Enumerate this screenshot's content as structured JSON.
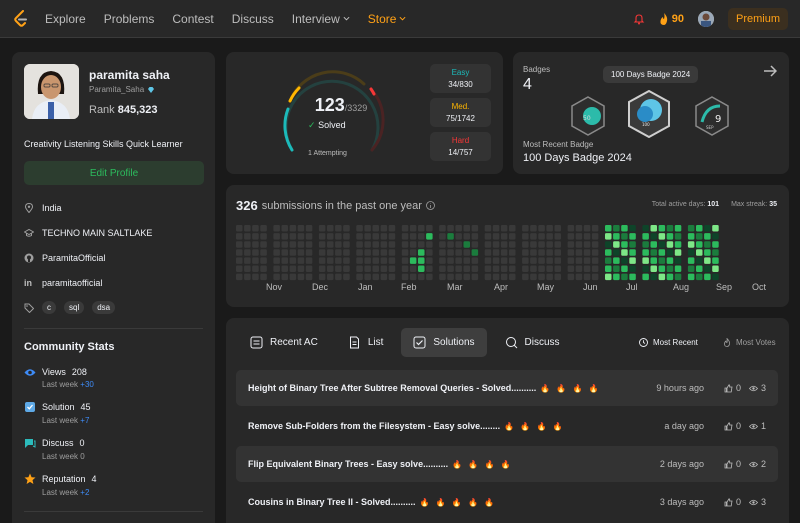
{
  "nav": {
    "items": [
      "Explore",
      "Problems",
      "Contest",
      "Discuss"
    ],
    "interview": "Interview",
    "store": "Store",
    "streak": "90",
    "premium": "Premium"
  },
  "profile": {
    "name": "paramita saha",
    "username": "Paramita_Saha",
    "rank_label": "Rank",
    "rank_value": "845,323",
    "bio": "Creativity Listening Skills Quick Learner",
    "edit_button": "Edit Profile",
    "location": "India",
    "school": "TECHNO MAIN SALTLAKE",
    "github": "ParamitaOfficial",
    "linkedin": "paramitaofficial",
    "tags": [
      "c",
      "sql",
      "dsa"
    ]
  },
  "community": {
    "title": "Community Stats",
    "stats": [
      {
        "label": "Views",
        "value": "208",
        "sub": "Last week",
        "delta": "+30",
        "color": "#3e8bf6"
      },
      {
        "label": "Solution",
        "value": "45",
        "sub": "Last week",
        "delta": "+7",
        "color": "#3e8bf6"
      },
      {
        "label": "Discuss",
        "value": "0",
        "sub": "Last week",
        "delta": "0",
        "color": "#2cbbbb"
      },
      {
        "label": "Reputation",
        "value": "4",
        "sub": "Last week",
        "delta": "+2",
        "color": "#ffa116"
      }
    ]
  },
  "solved": {
    "count": "123",
    "total": "/3329",
    "label": "Solved",
    "attempting": "1 Attempting",
    "easy_label": "Easy",
    "easy_value": "34/830",
    "medium_label": "Med.",
    "medium_value": "75/1742",
    "hard_label": "Hard",
    "hard_value": "14/757",
    "colors": {
      "easy": "#1cbaba",
      "medium": "#ffb700",
      "hard": "#f63737"
    }
  },
  "badges": {
    "label": "Badges",
    "count": "4",
    "tooltip": "100 Days Badge 2024",
    "recent_label": "Most Recent Badge",
    "recent_value": "100 Days Badge 2024",
    "items": [
      {
        "name": "badge-50-days",
        "text": "50"
      },
      {
        "name": "badge-100-days",
        "text": "100"
      },
      {
        "name": "badge-sep",
        "text": "SEP"
      }
    ]
  },
  "heatmap": {
    "count": "326",
    "title": "submissions in the past one year",
    "active_label": "Total active days:",
    "active_value": "101",
    "streak_label": "Max streak:",
    "streak_value": "35",
    "months": [
      "Nov",
      "Dec",
      "Jan",
      "Feb",
      "Mar",
      "Apr",
      "May",
      "Jun",
      "Jul",
      "Aug",
      "Sep",
      "Oct"
    ],
    "colors": {
      "empty": "#393939",
      "l1": "#0e4429",
      "l2": "#1b7c3d",
      "l3": "#2cbb5d",
      "l4": "#7ee787"
    }
  },
  "solutions": {
    "tabs": [
      "Recent AC",
      "List",
      "Solutions",
      "Discuss"
    ],
    "active_tab": "Solutions",
    "sort_recent": "Most Recent",
    "sort_votes": "Most Votes",
    "rows": [
      {
        "title": "Height of Binary Tree After Subtree Removal Queries - Solved..........",
        "fires": "🔥 🔥 🔥 🔥",
        "time": "9 hours ago",
        "likes": "0",
        "views": "3"
      },
      {
        "title": "Remove Sub-Folders from the Filesystem - Easy solve........",
        "fires": "🔥 🔥 🔥 🔥",
        "time": "a day ago",
        "likes": "0",
        "views": "1"
      },
      {
        "title": "Flip Equivalent Binary Trees - Easy solve..........",
        "fires": "🔥 🔥 🔥 🔥",
        "time": "2 days ago",
        "likes": "0",
        "views": "2"
      },
      {
        "title": "Cousins in Binary Tree II - Solved..........",
        "fires": "🔥 🔥 🔥 🔥 🔥",
        "time": "3 days ago",
        "likes": "0",
        "views": "3"
      }
    ]
  }
}
